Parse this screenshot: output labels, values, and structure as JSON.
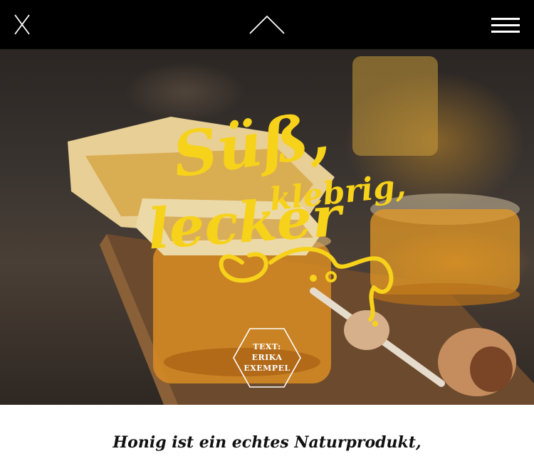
{
  "nav": {
    "close_icon": "close-icon",
    "up_icon": "chevron-up-icon",
    "menu_icon": "hamburger-menu-icon"
  },
  "hero": {
    "headline": {
      "line1": "Süß,",
      "line2": "klebrig,",
      "line3": "lecker"
    },
    "author_badge": {
      "label": "TEXT:",
      "first_name": "ERIKA",
      "last_name": "EXEMPEL"
    }
  },
  "article": {
    "lead": "Honig ist ein echtes Naturprodukt,"
  },
  "colors": {
    "topbar": "#000000",
    "lettering": "#f7d21a",
    "badge_text": "#ffffff",
    "lead_text": "#111111"
  }
}
